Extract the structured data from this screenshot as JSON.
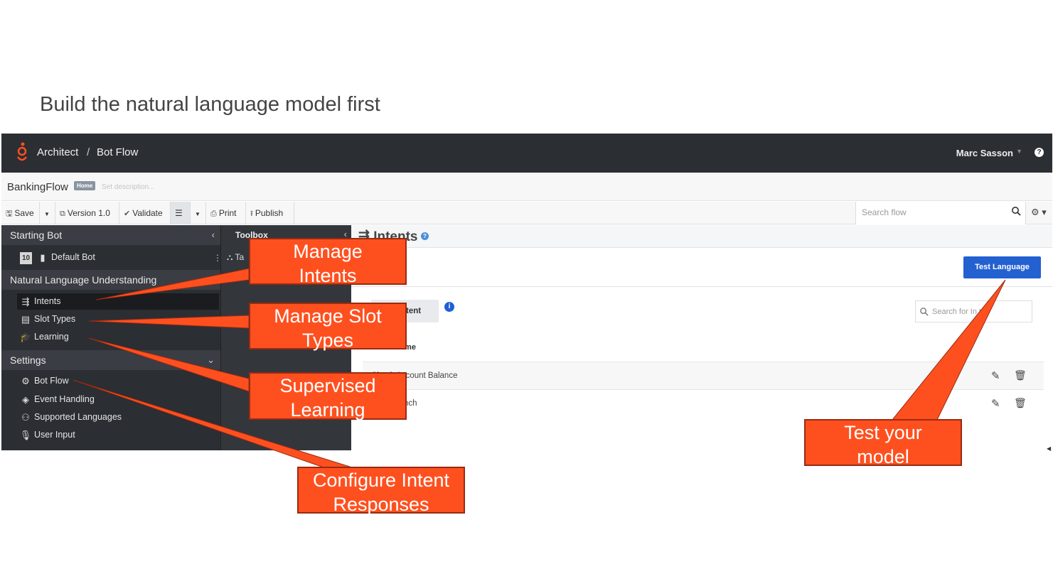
{
  "slide": {
    "title": "Build the natural language model first"
  },
  "header": {
    "breadcrumb": [
      "Architect",
      "/",
      "Bot Flow"
    ],
    "user": "Marc Sasson",
    "help_icon": "question-circle-icon"
  },
  "flow": {
    "name": "BankingFlow",
    "badge": "Home",
    "description_placeholder": "Set description..."
  },
  "toolbar": {
    "save": "Save",
    "version": "Version 1.0",
    "validate": "Validate",
    "print": "Print",
    "publish": "Publish",
    "search_placeholder": "Search flow"
  },
  "leftnav": {
    "starting_bot": {
      "label": "Starting Bot",
      "version": "10",
      "item": "Default Bot"
    },
    "nlu": {
      "label": "Natural Language Understanding",
      "items": [
        "Intents",
        "Slot Types",
        "Learning"
      ]
    },
    "settings": {
      "label": "Settings",
      "items": [
        "Bot Flow",
        "Event Handling",
        "Supported Languages",
        "User Input"
      ]
    }
  },
  "toolbox": {
    "title": "Toolbox",
    "item": "Ta"
  },
  "main": {
    "title": "Intents",
    "test_button": "Test Language",
    "add_intent": "ntent",
    "search_placeholder": "Search for In   t",
    "column_header": "Intent Name",
    "rows": [
      "Check Account Balance",
      "nch"
    ]
  },
  "callouts": {
    "manage_intents": [
      "Manage",
      "Intents"
    ],
    "manage_slot_types": [
      "Manage Slot",
      "Types"
    ],
    "supervised_learning": [
      "Supervised",
      "Learning"
    ],
    "configure_intent": [
      "Configure Intent",
      "Responses"
    ],
    "test_model": [
      "Test your",
      "model"
    ]
  },
  "colors": {
    "callout": "#fe501f",
    "header_bg": "#2b2e33",
    "accent_blue": "#2360d0"
  }
}
